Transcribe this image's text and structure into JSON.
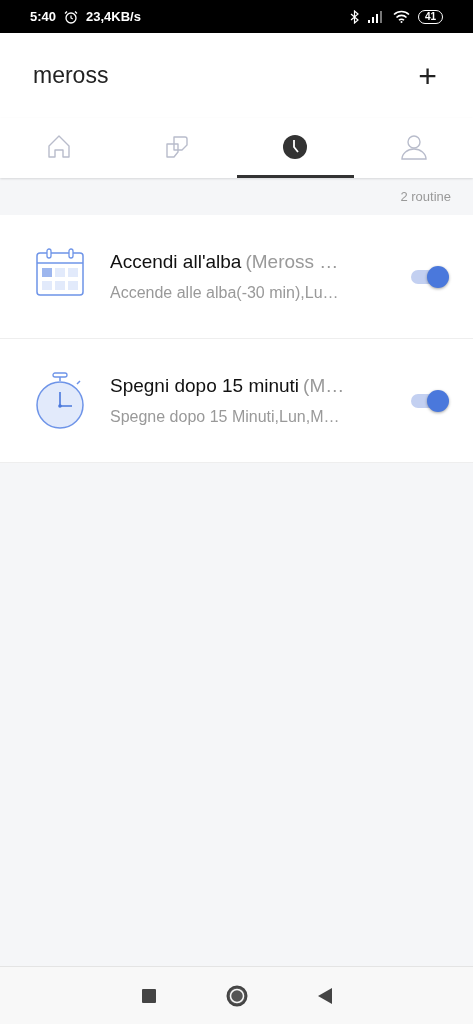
{
  "status_bar": {
    "time": "5:40",
    "speed": "23,4KB/s",
    "battery": "41"
  },
  "header": {
    "title": "meross",
    "add": "+"
  },
  "tabs": [
    {
      "kind": "home",
      "selected": false
    },
    {
      "kind": "devices",
      "selected": false
    },
    {
      "kind": "clock",
      "selected": true
    },
    {
      "kind": "user",
      "selected": false
    }
  ],
  "count": "2 routine",
  "routines": [
    {
      "kind": "calendar",
      "name": "Accendi all'alba",
      "device": "(Meross …",
      "detail": "Accende alle alba(-30 min),Lu…",
      "on": true
    },
    {
      "kind": "timer",
      "name": "Spegni dopo 15 minuti",
      "device": "(M…",
      "detail": "Spegne dopo 15 Minuti,Lun,M…",
      "on": true
    }
  ]
}
